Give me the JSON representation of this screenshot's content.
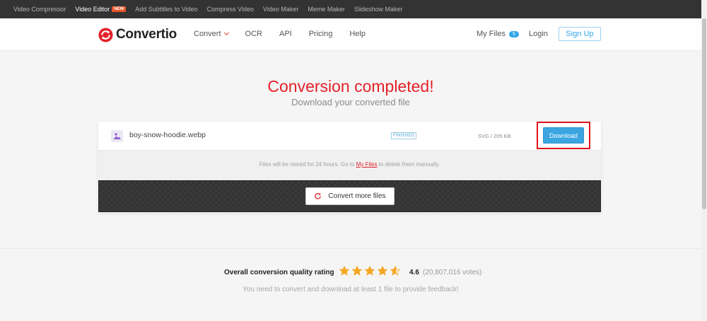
{
  "topbar": {
    "links": [
      "Video Compressor",
      "Video Editor",
      "Add Subtitles to Video",
      "Compress Video",
      "Video Maker",
      "Meme Maker",
      "Slideshow Maker"
    ],
    "new_badge": "NEW"
  },
  "header": {
    "logo": "Convertio",
    "nav": {
      "convert": "Convert",
      "ocr": "OCR",
      "api": "API",
      "pricing": "Pricing",
      "help": "Help"
    },
    "my_files": "My Files",
    "my_files_count": "5",
    "login": "Login",
    "signup": "Sign Up"
  },
  "main": {
    "title": "Conversion completed!",
    "subtitle": "Download your converted file"
  },
  "file": {
    "name": "boy-snow-hoodie.webp",
    "status": "FINISHED",
    "size": "SVG / 205 KB",
    "download": "Download"
  },
  "note": {
    "before": "Files will be stored for 24 hours. Go to ",
    "link": "My Files",
    "after": " to delete them manually."
  },
  "convert_more": "Convert more files",
  "rating": {
    "label": "Overall conversion quality rating",
    "value": 4.6,
    "score": "4.6",
    "votes": "(20,807,016 votes)",
    "feedback": "You need to convert and download at least 1 file to provide feedback!"
  },
  "colors": {
    "accent": "#e3222a",
    "primary": "#3aa5e0",
    "star": "#f5a623"
  }
}
